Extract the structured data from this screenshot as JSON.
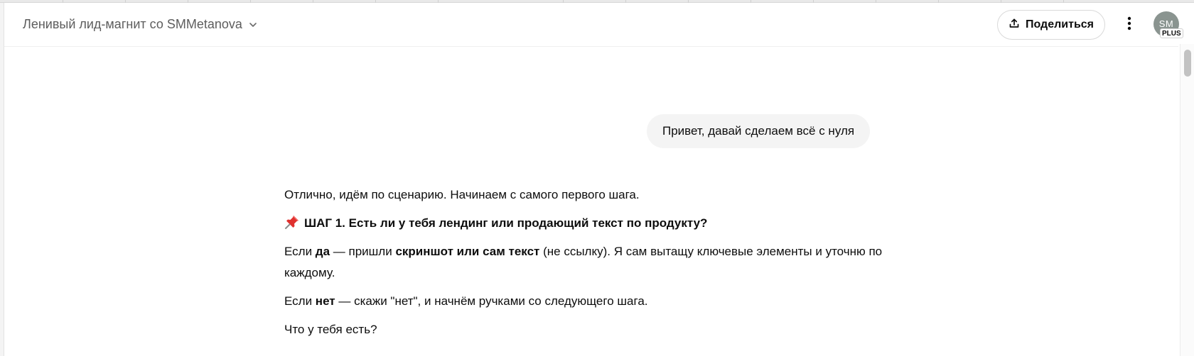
{
  "header": {
    "chat_title": "Ленивый лид-магнит со SMMetanova",
    "share_label": "Поделиться",
    "avatar_initials": "SM",
    "plan_badge": "PLUS"
  },
  "conversation": {
    "user_message": "Привет, давай сделаем всё с нуля",
    "assistant": {
      "intro": "Отлично, идём по сценарию. Начинаем с самого первого шага.",
      "step_heading": "ШАГ 1. Есть ли у тебя лендинг или продающий текст по продукту?",
      "p1_before": "Если ",
      "p1_bold1": "да",
      "p1_middle": " — пришли ",
      "p1_bold2": "скриншот или сам текст",
      "p1_after": " (не ссылку). Я сам вытащу ключевые элементы и уточню по каждому.",
      "p2_before": "Если ",
      "p2_bold": "нет",
      "p2_after": " — скажи \"нет\", и начнём ручками со следующего шага.",
      "question": "Что у тебя есть?"
    }
  },
  "icons": {
    "title_chevron": "chevron-down-icon",
    "share": "share-upload-icon",
    "more": "more-vertical-icon",
    "step_marker": "pushpin-icon"
  }
}
